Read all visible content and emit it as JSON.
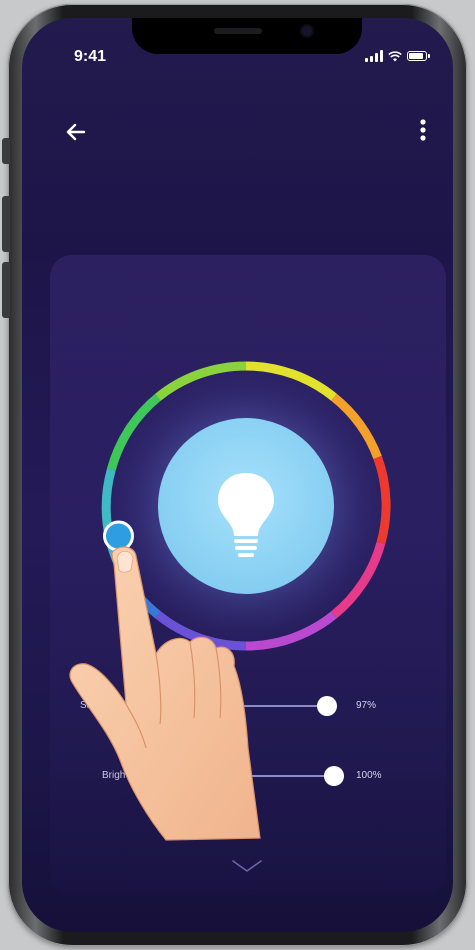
{
  "status_bar": {
    "time": "9:41"
  },
  "icons": {
    "back": "arrow-left-icon",
    "more": "more-vertical-icon",
    "bulb": "light-bulb-icon",
    "expand": "chevron-down-icon"
  },
  "controls": {
    "saturation": {
      "label": "Sat",
      "value": "97%",
      "level": 0.97
    },
    "brightness": {
      "label": "Brigh",
      "value": "100%",
      "level": 1.0
    }
  },
  "colors": {
    "background": "#1d1548",
    "bulb_circle": "#8fd4f5",
    "knob": "#2f9ee0",
    "slider_knob": "#ffffff"
  }
}
